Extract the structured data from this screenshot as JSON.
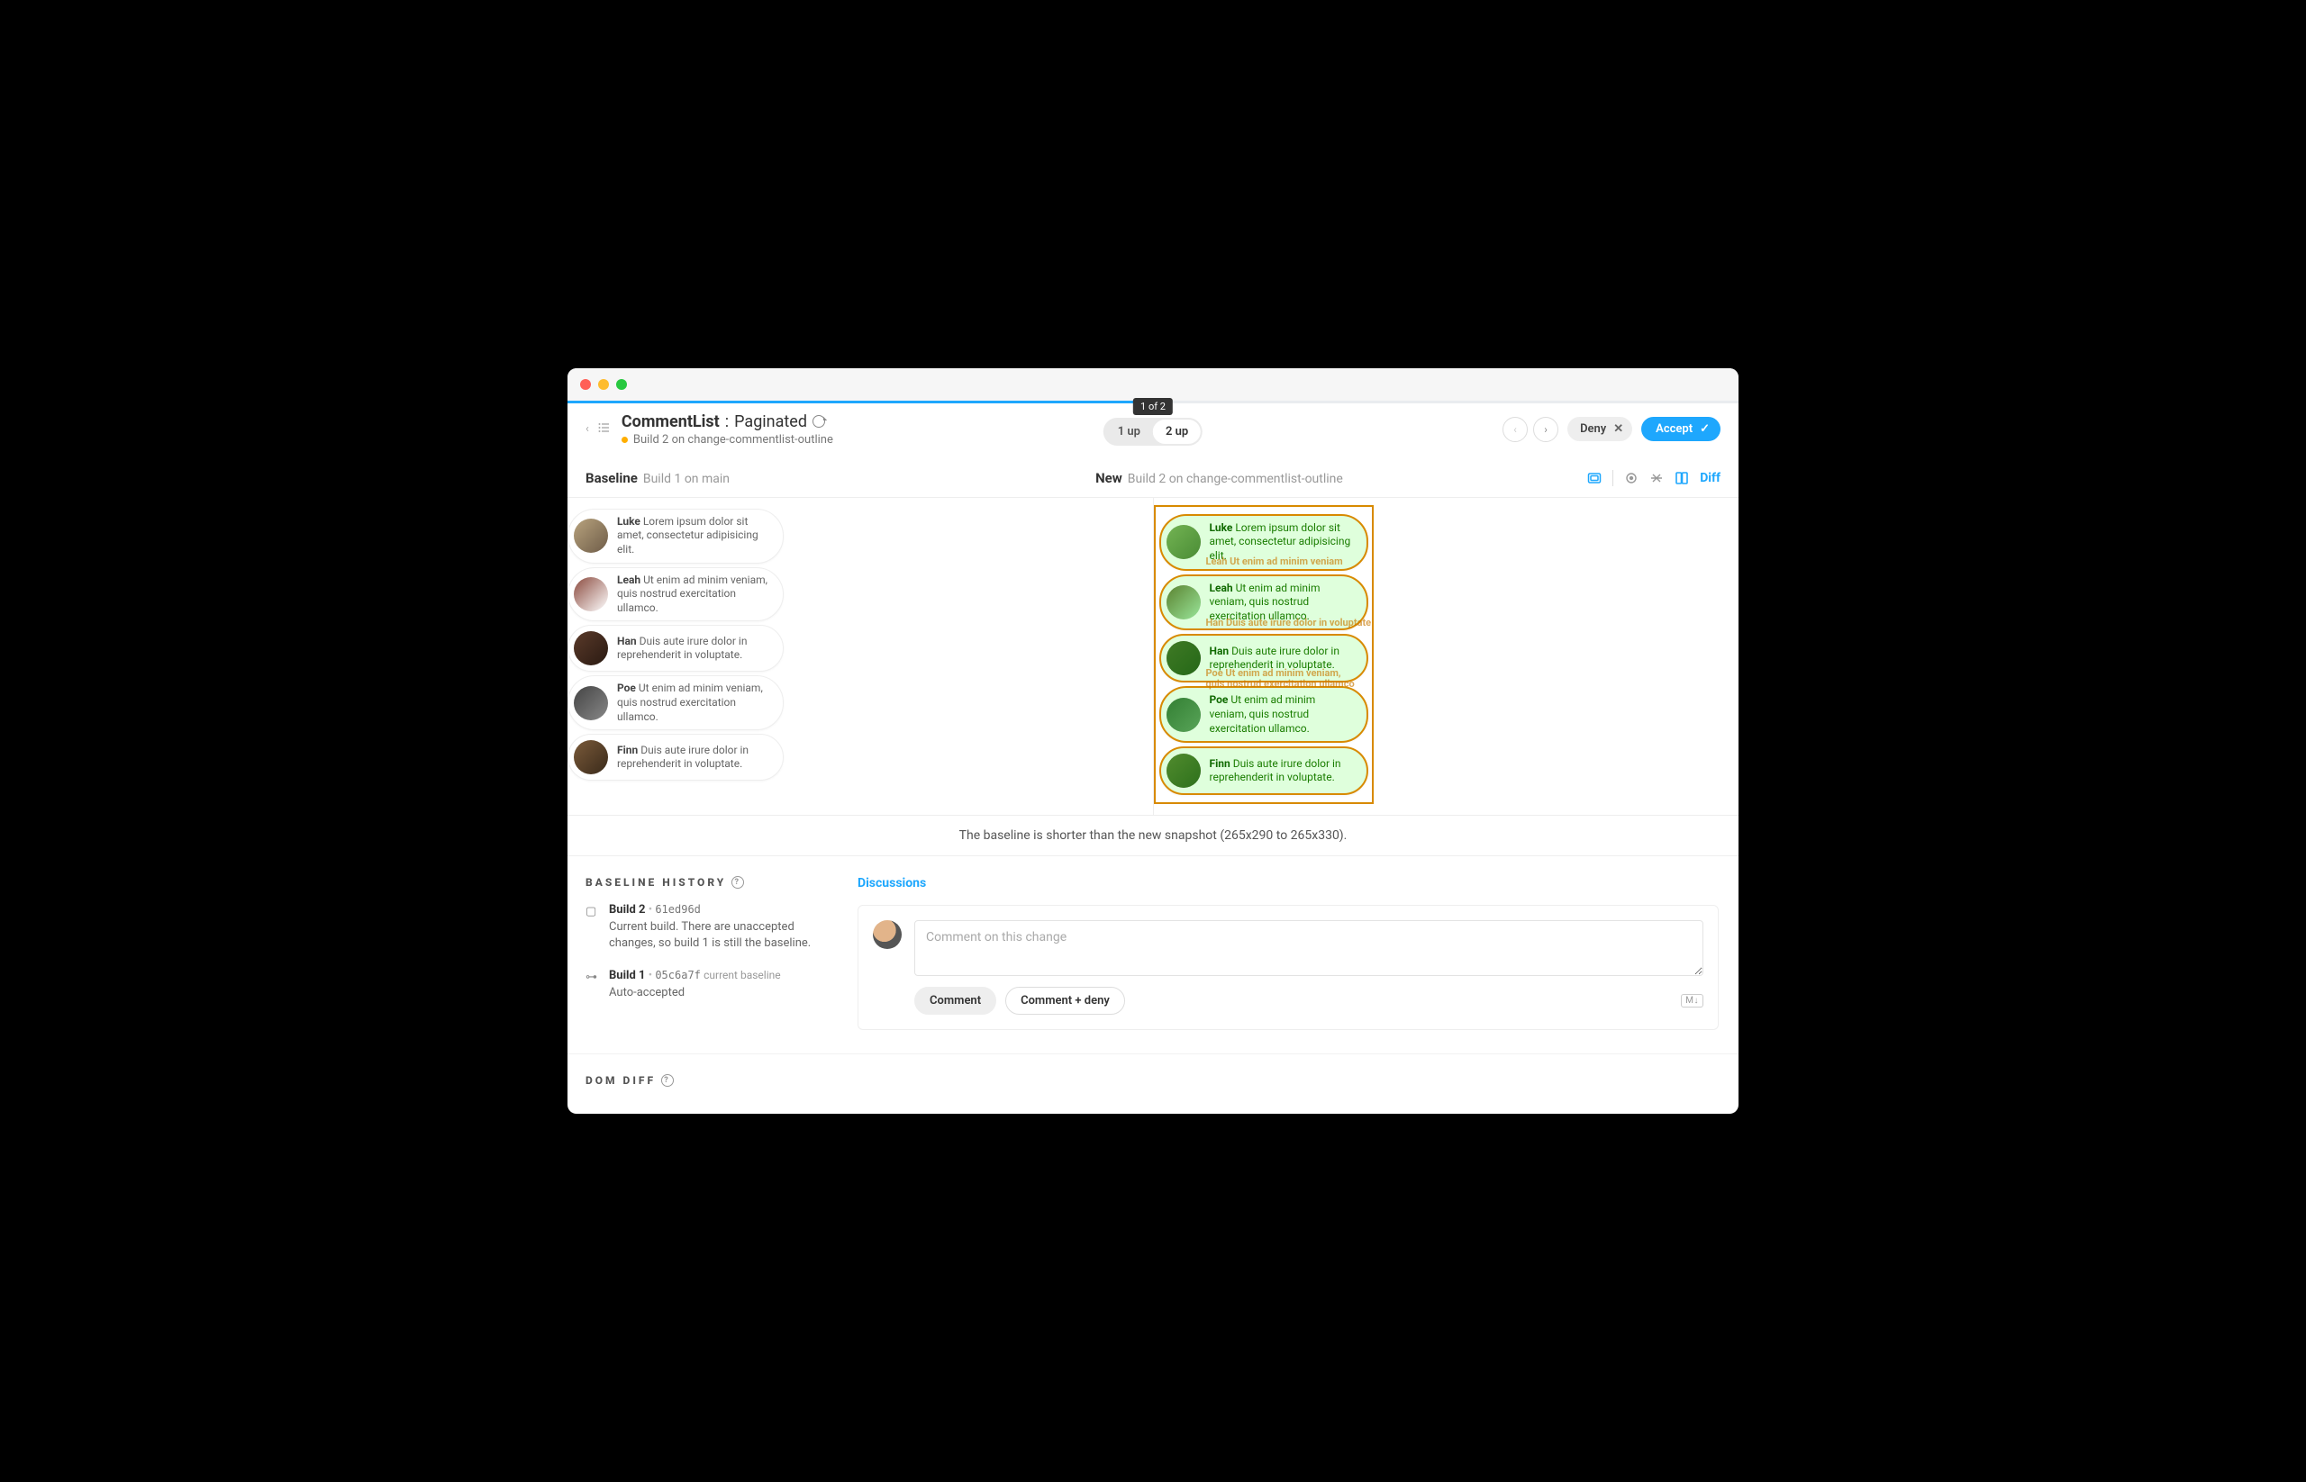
{
  "tooltip": "1 of 2",
  "header": {
    "story": "CommentList",
    "variant": "Paginated",
    "subtitle": "Build 2 on change-commentlist-outline"
  },
  "toggle": {
    "one_up": "1 up",
    "two_up": "2 up"
  },
  "actions": {
    "deny": "Deny",
    "accept": "Accept"
  },
  "subheader": {
    "baseline_label": "Baseline",
    "baseline_desc": "Build 1 on main",
    "new_label": "New",
    "new_desc": "Build 2 on change-commentlist-outline",
    "diff": "Diff"
  },
  "baseline_comments": [
    {
      "name": "Luke",
      "text": "Lorem ipsum dolor sit amet, consectetur adipisicing elit."
    },
    {
      "name": "Leah",
      "text": "Ut enim ad minim veniam, quis nostrud exercitation ullamco."
    },
    {
      "name": "Han",
      "text": "Duis aute irure dolor in reprehenderit in voluptate."
    },
    {
      "name": "Poe",
      "text": "Ut enim ad minim veniam, quis nostrud exercitation ullamco."
    },
    {
      "name": "Finn",
      "text": "Duis aute irure dolor in reprehenderit in voluptate."
    }
  ],
  "new_comments": [
    {
      "name": "Luke",
      "text": "Lorem ipsum dolor sit amet, consectetur adipisicing elit."
    },
    {
      "name": "Leah",
      "text": "Ut enim ad minim veniam, quis nostrud exercitation ullamco."
    },
    {
      "name": "Han",
      "text": "Duis aute irure dolor in reprehenderit in voluptate."
    },
    {
      "name": "Poe",
      "text": "Ut enim ad minim veniam, quis nostrud exercitation ullamco."
    },
    {
      "name": "Finn",
      "text": "Duis aute irure dolor in reprehenderit in voluptate."
    }
  ],
  "size_note": "The baseline is shorter than the new snapshot (265x290 to 265x330).",
  "history": {
    "title": "BASELINE HISTORY",
    "items": [
      {
        "build": "Build 2",
        "hash": "61ed96d",
        "tag": "",
        "desc": "Current build. There are unaccepted changes, so build 1 is still the baseline."
      },
      {
        "build": "Build 1",
        "hash": "05c6a7f",
        "tag": "current baseline",
        "desc": "Auto-accepted"
      }
    ]
  },
  "discussions": {
    "title": "Discussions",
    "placeholder": "Comment on this change",
    "comment_btn": "Comment",
    "comment_deny_btn": "Comment + deny",
    "md_badge": "M↓"
  },
  "domdiff_title": "DOM DIFF"
}
